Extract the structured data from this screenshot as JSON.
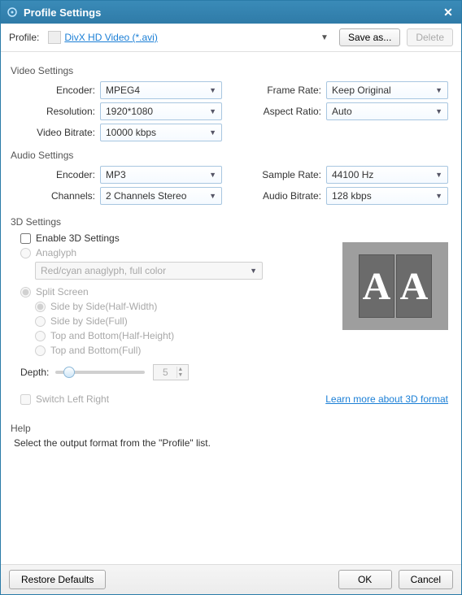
{
  "window": {
    "title": "Profile Settings"
  },
  "toolbar": {
    "profile_label": "Profile:",
    "profile_value": "DivX HD Video (*.avi)",
    "save_as_label": "Save as...",
    "delete_label": "Delete"
  },
  "video": {
    "group_label": "Video Settings",
    "encoder_label": "Encoder:",
    "encoder_value": "MPEG4",
    "resolution_label": "Resolution:",
    "resolution_value": "1920*1080",
    "bitrate_label": "Video Bitrate:",
    "bitrate_value": "10000 kbps",
    "framerate_label": "Frame Rate:",
    "framerate_value": "Keep Original",
    "aspect_label": "Aspect Ratio:",
    "aspect_value": "Auto"
  },
  "audio": {
    "group_label": "Audio Settings",
    "encoder_label": "Encoder:",
    "encoder_value": "MP3",
    "channels_label": "Channels:",
    "channels_value": "2 Channels Stereo",
    "samplerate_label": "Sample Rate:",
    "samplerate_value": "44100 Hz",
    "bitrate_label": "Audio Bitrate:",
    "bitrate_value": "128 kbps"
  },
  "threeD": {
    "group_label": "3D Settings",
    "enable_label": "Enable 3D Settings",
    "anaglyph_label": "Anaglyph",
    "anaglyph_value": "Red/cyan anaglyph, full color",
    "split_label": "Split Screen",
    "split_options": {
      "sbs_half": "Side by Side(Half-Width)",
      "sbs_full": "Side by Side(Full)",
      "tab_half": "Top and Bottom(Half-Height)",
      "tab_full": "Top and Bottom(Full)"
    },
    "depth_label": "Depth:",
    "depth_value": "5",
    "switch_label": "Switch Left Right",
    "learn_more": "Learn more about 3D format",
    "preview_letter": "A"
  },
  "help": {
    "group_label": "Help",
    "text": "Select the output format from the \"Profile\" list."
  },
  "footer": {
    "restore_label": "Restore Defaults",
    "ok_label": "OK",
    "cancel_label": "Cancel"
  }
}
